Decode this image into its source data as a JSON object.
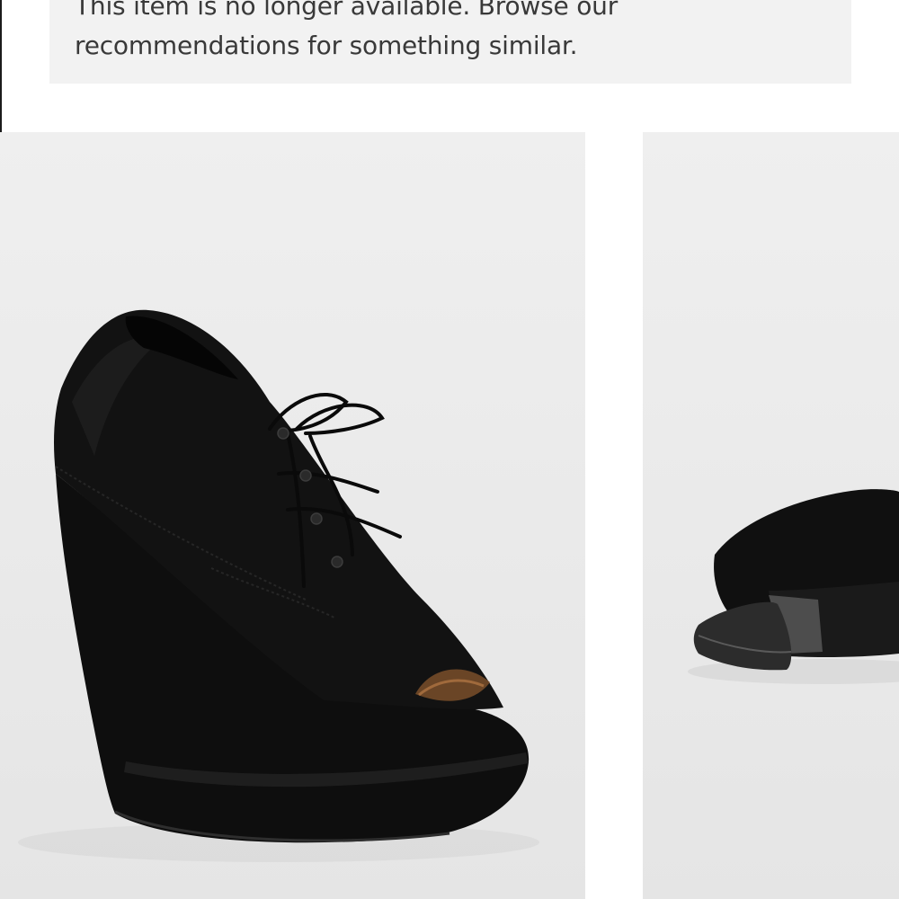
{
  "notice": {
    "line1": "This item is no longer available. Browse our",
    "line2": "recommendations for something similar."
  },
  "gallery": {
    "images": [
      {
        "icon": "black-suede-lace-up-peep-toe-wedge-bootie"
      },
      {
        "icon": "black-wedge-shoe-rear-view"
      }
    ]
  }
}
